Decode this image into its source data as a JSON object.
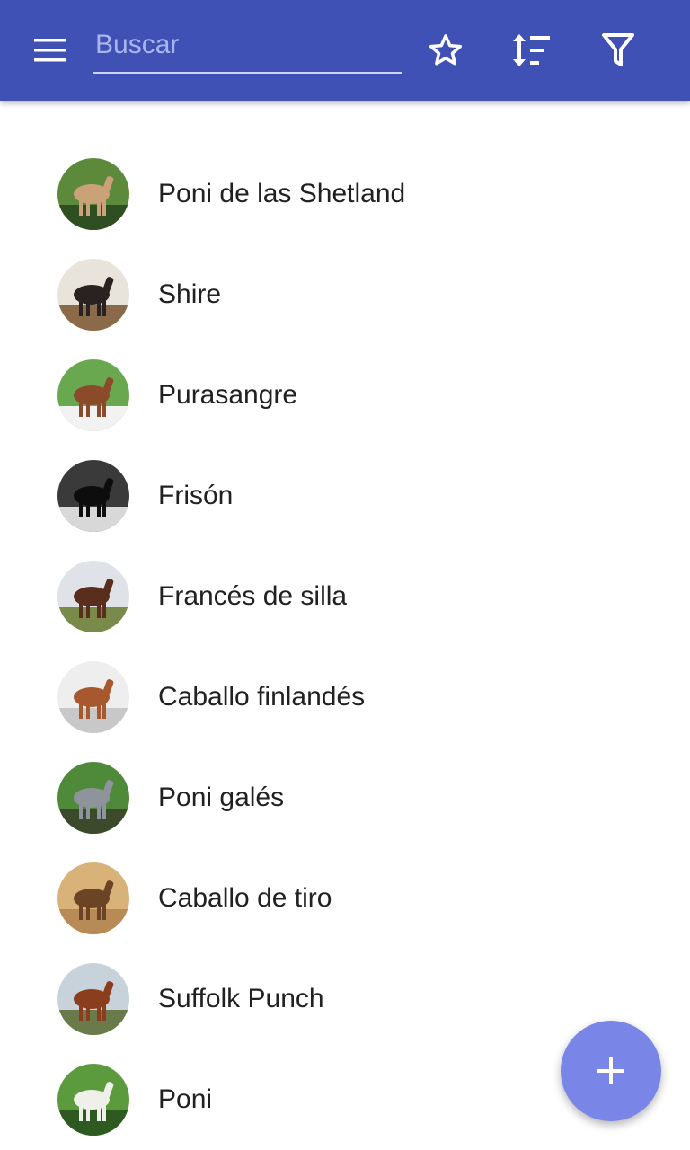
{
  "appbar": {
    "search": {
      "placeholder": "Buscar",
      "value": ""
    },
    "icons": {
      "menu": "menu-icon",
      "favorite": "star-outline-icon",
      "sort": "sort-icon",
      "filter": "filter-icon"
    },
    "color": "#3f51b5"
  },
  "breeds": [
    {
      "name": "Poni de las Shetland",
      "thumb": "shetland-pony-photo",
      "palette": [
        "#5c8a3a",
        "#c9a27a",
        "#2f4f22"
      ]
    },
    {
      "name": "Shire",
      "thumb": "shire-horse-photo",
      "palette": [
        "#e8e4dc",
        "#2a2220",
        "#8b6a4a"
      ]
    },
    {
      "name": "Purasangre",
      "thumb": "thoroughbred-photo",
      "palette": [
        "#6aa84f",
        "#8b4a2a",
        "#f2f2f2"
      ]
    },
    {
      "name": "Frisón",
      "thumb": "friesian-horse-photo",
      "palette": [
        "#3a3a3a",
        "#0d0d0d",
        "#d8d8d8"
      ]
    },
    {
      "name": "Francés de silla",
      "thumb": "selle-francais-photo",
      "palette": [
        "#dfe3e8",
        "#5a2e1c",
        "#7a8a4a"
      ]
    },
    {
      "name": "Caballo finlandés",
      "thumb": "finnhorse-photo",
      "palette": [
        "#eeeeee",
        "#a8582e",
        "#c8c8c8"
      ]
    },
    {
      "name": "Poni galés",
      "thumb": "welsh-pony-photo",
      "palette": [
        "#4e8a3a",
        "#8e939c",
        "#3a4a2a"
      ]
    },
    {
      "name": "Caballo de tiro",
      "thumb": "draft-horse-painting",
      "palette": [
        "#d9b27a",
        "#6a4424",
        "#b88a56"
      ]
    },
    {
      "name": "Suffolk Punch",
      "thumb": "suffolk-punch-photo",
      "palette": [
        "#c8d2da",
        "#8a3e1e",
        "#6a7a4a"
      ]
    },
    {
      "name": "Poni",
      "thumb": "pony-photo",
      "palette": [
        "#5c9a3e",
        "#f0f0ea",
        "#2e5a22"
      ]
    }
  ],
  "fab": {
    "icon": "plus-icon",
    "color": "#7986e8"
  }
}
